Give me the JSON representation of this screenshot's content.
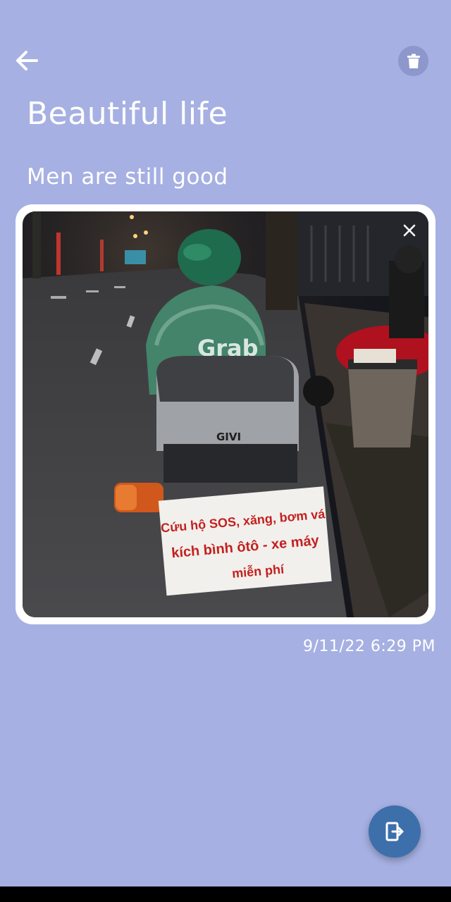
{
  "colors": {
    "background": "#a6b0e2",
    "card": "#ffffff",
    "fab": "#3d6fab",
    "delete_button": "#8d97cc",
    "text": "#ffffff"
  },
  "header": {
    "back_icon": "arrow-left-icon",
    "delete_icon": "trash-icon"
  },
  "note": {
    "title": "Beautiful life",
    "body": "Men are still good",
    "timestamp": "9/11/22 6:29 PM"
  },
  "photo": {
    "close_icon": "close-icon",
    "sign_lines": [
      "Cứu hộ SOS, xăng, bơm vá",
      "kích bình ôtô - xe máy",
      "miễn phí"
    ],
    "jacket_text": "Grab",
    "box_brand": "GIVI"
  },
  "fab": {
    "icon": "exit-icon"
  }
}
